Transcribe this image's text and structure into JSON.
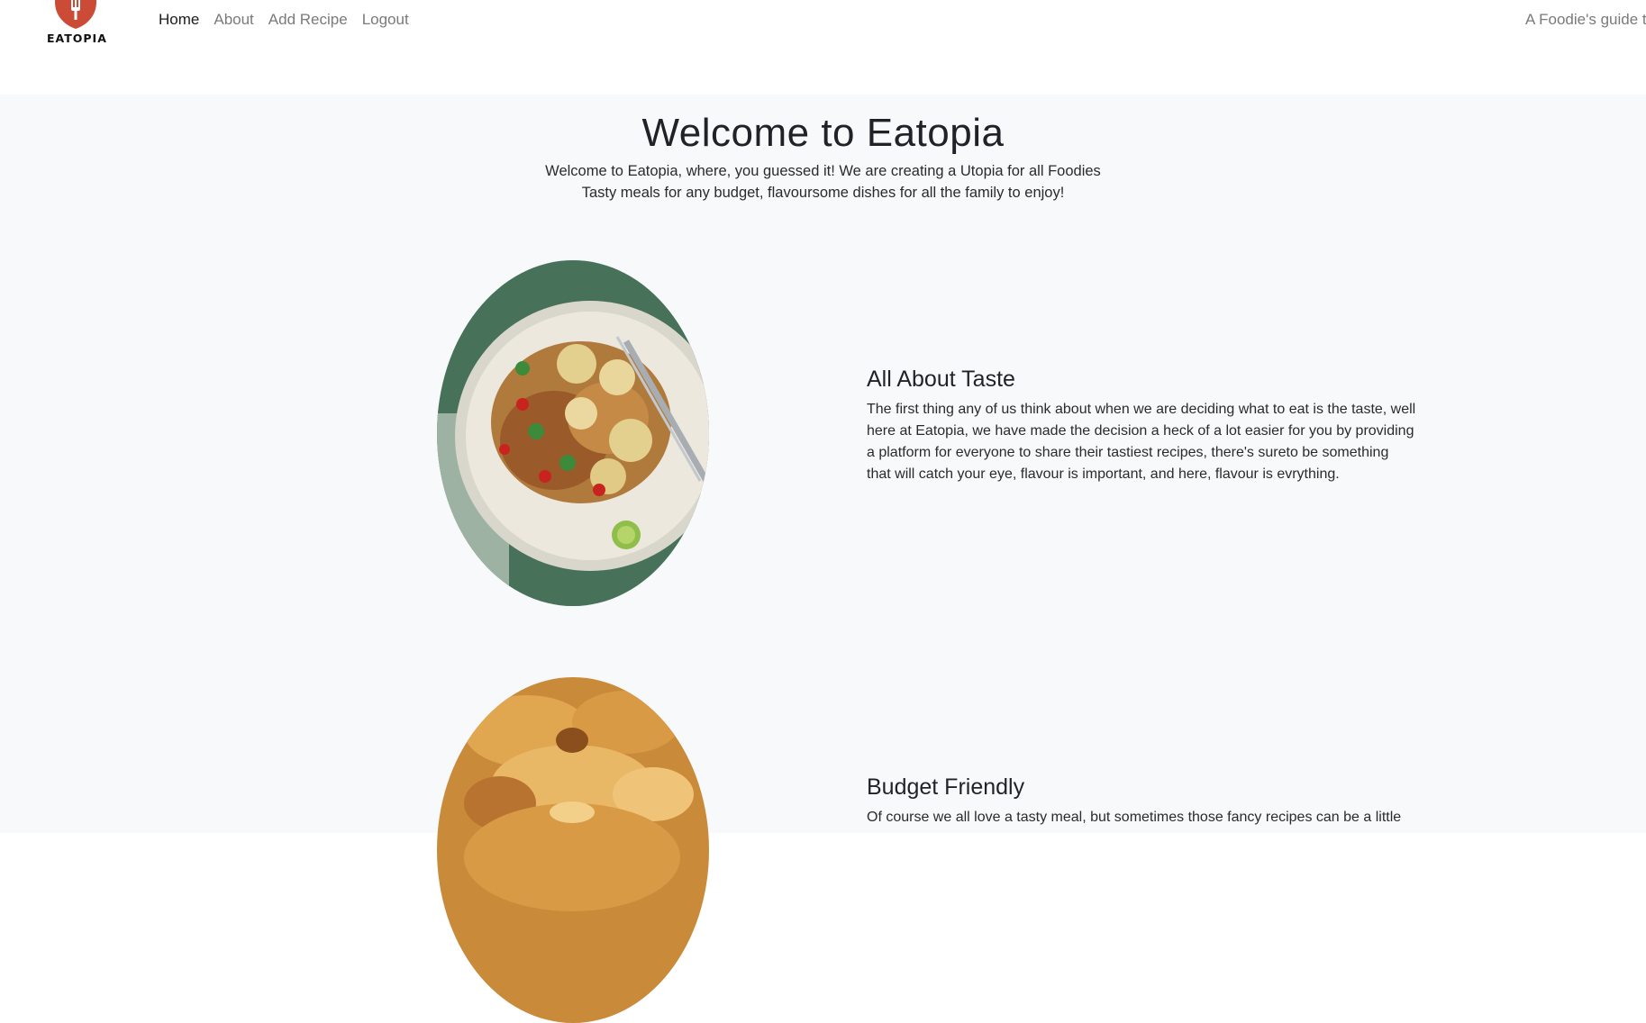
{
  "brand": {
    "name": "EATOPIA",
    "logo_color": "#cc4b37"
  },
  "nav": {
    "items": [
      {
        "label": "Home"
      },
      {
        "label": "About"
      },
      {
        "label": "Add Recipe"
      },
      {
        "label": "Logout"
      }
    ],
    "active": "Home"
  },
  "tagline": "A Foodie's guide to",
  "hero": {
    "title": "Welcome to Eatopia",
    "line1": "Welcome to Eatopia, where, you guessed it! We are creating a Utopia for all Foodies",
    "line2": "Tasty meals for any budget, flavoursome dishes for all the family to enjoy!"
  },
  "features": [
    {
      "title": "All About Taste",
      "text": "The first thing any of us think about when we are deciding what to eat is the taste, well here at Eatopia, we have made the decision a heck of a lot easier for you by providing a platform for everyone to share their tastiest recipes, there's sureto be something that will catch your eye, flavour is important, and here, flavour is evrything.",
      "image": "chicken-potatoes-plate"
    },
    {
      "title": "Budget Friendly",
      "text": "Of course we all love a tasty meal, but sometimes those fancy recipes can be a little",
      "image": "pie-crust"
    }
  ],
  "colors": {
    "page_bg": "#f8f9fa",
    "nav_bg": "#ffffff",
    "text": "#212529",
    "muted": "#7a7a7a"
  }
}
